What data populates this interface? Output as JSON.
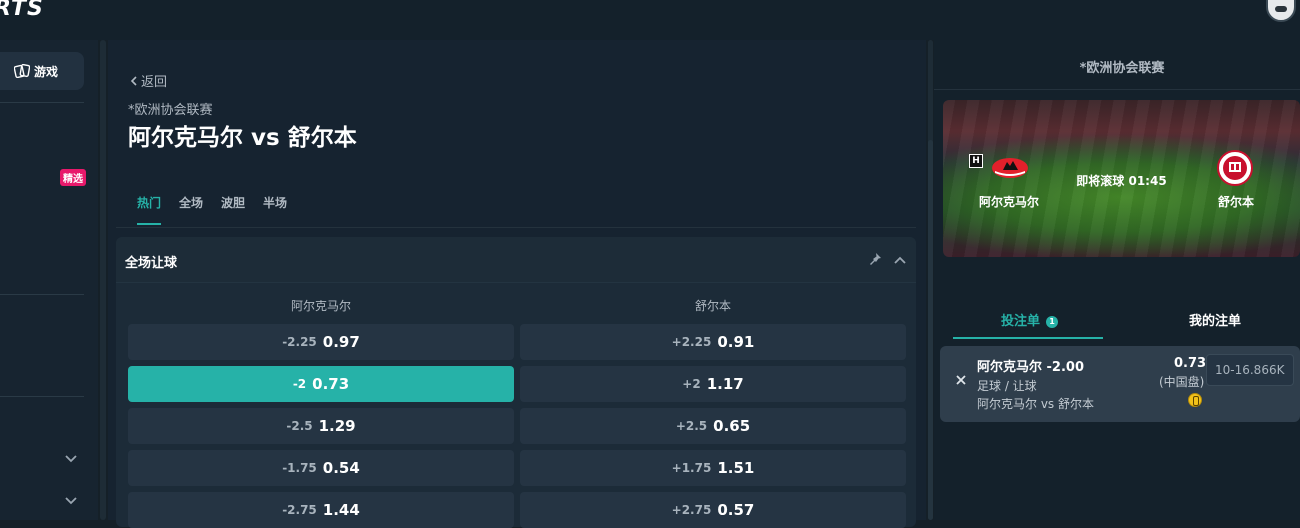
{
  "header": {
    "logo": "RTS"
  },
  "sidebar": {
    "game_label": "游戏",
    "badge": "精选"
  },
  "main": {
    "back_label": "返回",
    "league": "*欧洲协会联赛",
    "match_title": "阿尔克马尔 vs 舒尔本",
    "tabs": [
      {
        "label": "热门",
        "active": true
      },
      {
        "label": "全场"
      },
      {
        "label": "波胆"
      },
      {
        "label": "半场"
      }
    ],
    "market": {
      "title": "全场让球",
      "home_header": "阿尔克马尔",
      "away_header": "舒尔本",
      "rows": [
        {
          "home_line": "-2.25",
          "home_price": "0.97",
          "away_line": "+2.25",
          "away_price": "0.91"
        },
        {
          "home_line": "-2",
          "home_price": "0.73",
          "away_line": "+2",
          "away_price": "1.17",
          "home_selected": true
        },
        {
          "home_line": "-2.5",
          "home_price": "1.29",
          "away_line": "+2.5",
          "away_price": "0.65"
        },
        {
          "home_line": "-1.75",
          "home_price": "0.54",
          "away_line": "+1.75",
          "away_price": "1.51"
        },
        {
          "home_line": "-2.75",
          "home_price": "1.44",
          "away_line": "+2.75",
          "away_price": "0.57"
        }
      ]
    }
  },
  "right_panel": {
    "league": "*欧洲协会联赛",
    "home_team": "阿尔克马尔",
    "away_team": "舒尔本",
    "home_marker": "H",
    "live_status": "即将滚球 01:45",
    "slip_tab": "投注单",
    "slip_count": "1",
    "my_bets_tab": "我的注单",
    "bet": {
      "selection": "阿尔克马尔 -2.00",
      "market": "足球 / 让球",
      "event": "阿尔克马尔 vs 舒尔本",
      "odds": "0.73",
      "odds_type": "(中国盘)",
      "stake_placeholder": "10-16.866K"
    }
  },
  "colors": {
    "accent": "#26b2a8",
    "badge": "#e8196b",
    "background": "#152028"
  }
}
